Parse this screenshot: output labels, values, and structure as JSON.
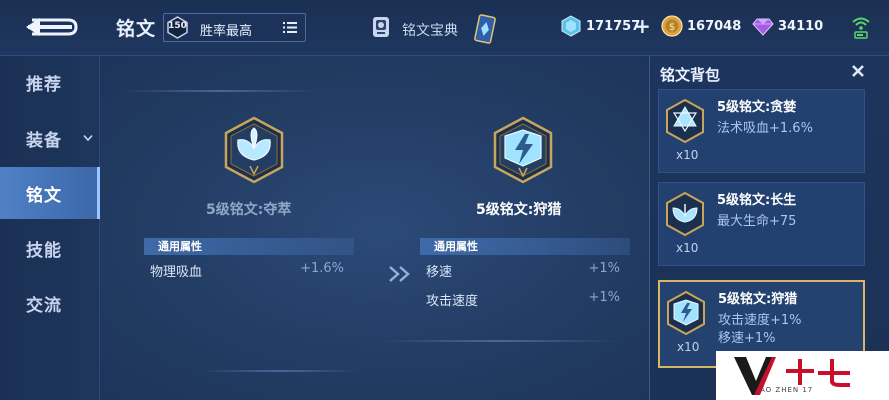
{
  "header": {
    "title": "铭文",
    "level_badge": "150",
    "filter_label": "胜率最高",
    "codex_label": "铭文宝典"
  },
  "currency": [
    {
      "icon": "diamond-icon",
      "value": "171757"
    },
    {
      "icon": "gold-coin-icon",
      "value": "167048"
    },
    {
      "icon": "gem-icon",
      "value": "34110"
    }
  ],
  "sidebar": {
    "items": [
      {
        "label": "推荐"
      },
      {
        "label": "装备"
      },
      {
        "label": "铭文"
      },
      {
        "label": "技能"
      },
      {
        "label": "交流"
      }
    ],
    "active_index": 2
  },
  "compare": {
    "left": {
      "name": "5级铭文:夺萃",
      "section": "通用属性",
      "attrs": [
        {
          "k": "物理吸血",
          "v": "+1.6%"
        }
      ]
    },
    "right": {
      "name": "5级铭文:狩猎",
      "section": "通用属性",
      "attrs": [
        {
          "k": "移速",
          "v": "+1%"
        },
        {
          "k": "攻击速度",
          "v": "+1%"
        }
      ]
    }
  },
  "bag": {
    "title": "铭文背包",
    "items": [
      {
        "name": "5级铭文:贪婪",
        "attrs": [
          "法术吸血+1.6%"
        ],
        "count": "x10",
        "selected": false
      },
      {
        "name": "5级铭文:长生",
        "attrs": [
          "最大生命+75"
        ],
        "count": "x10",
        "selected": false
      },
      {
        "name": "5级铭文:狩猎",
        "attrs": [
          "攻击速度+1%",
          "移速+1%"
        ],
        "count": "x10",
        "selected": true
      }
    ]
  },
  "watermark": {
    "text": "AO ZHEN 17",
    "logo_text": "十七"
  },
  "colors": {
    "accent": "#4f80c6",
    "selected_border": "#d7b766",
    "attr_value": "#88a8d2"
  }
}
